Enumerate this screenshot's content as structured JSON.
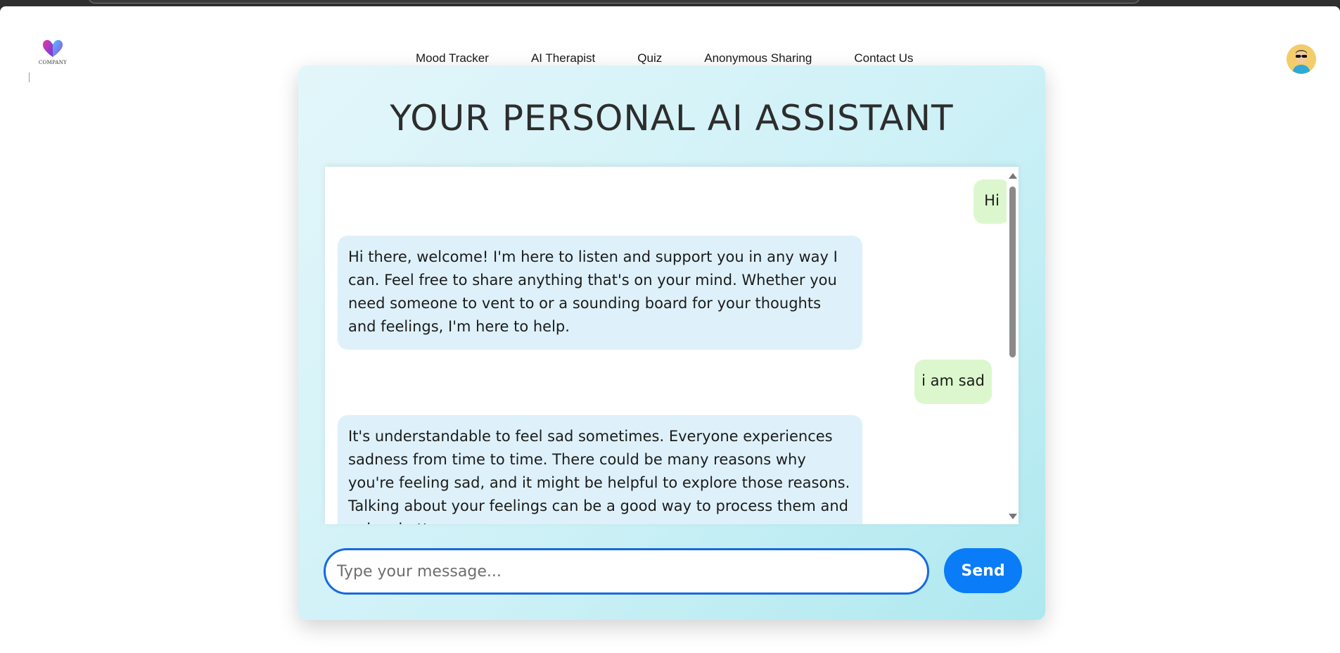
{
  "header": {
    "logo_text": "COMPANY",
    "nav": [
      {
        "label": "Mood Tracker"
      },
      {
        "label": "AI Therapist"
      },
      {
        "label": "Quiz"
      },
      {
        "label": "Anonymous Sharing"
      },
      {
        "label": "Contact Us"
      }
    ]
  },
  "chat": {
    "title": "YOUR PERSONAL AI ASSISTANT",
    "messages": [
      {
        "role": "user",
        "text": "Hi"
      },
      {
        "role": "bot",
        "text": "Hi there, welcome! I'm here to listen and support you in any way I can. Feel free to share anything that's on your mind. Whether you need someone to vent to or a sounding board for your thoughts and feelings, I'm here to help."
      },
      {
        "role": "user",
        "text": "i am sad"
      },
      {
        "role": "bot",
        "text": "It's understandable to feel sad sometimes. Everyone experiences sadness from time to time. There could be many reasons why you're feeling sad, and it might be helpful to explore those reasons. Talking about your feelings can be a good way to process them and gain a better"
      }
    ],
    "input": {
      "value": "",
      "placeholder": "Type your message..."
    },
    "send_label": "Send"
  },
  "colors": {
    "accent": "#0a7cf7",
    "input_border": "#1769e0",
    "user_bubble": "#dcf7cd",
    "bot_bubble": "#def1fa"
  },
  "icons": {
    "logo": "heart-logo-icon",
    "avatar": "user-avatar-icon"
  }
}
